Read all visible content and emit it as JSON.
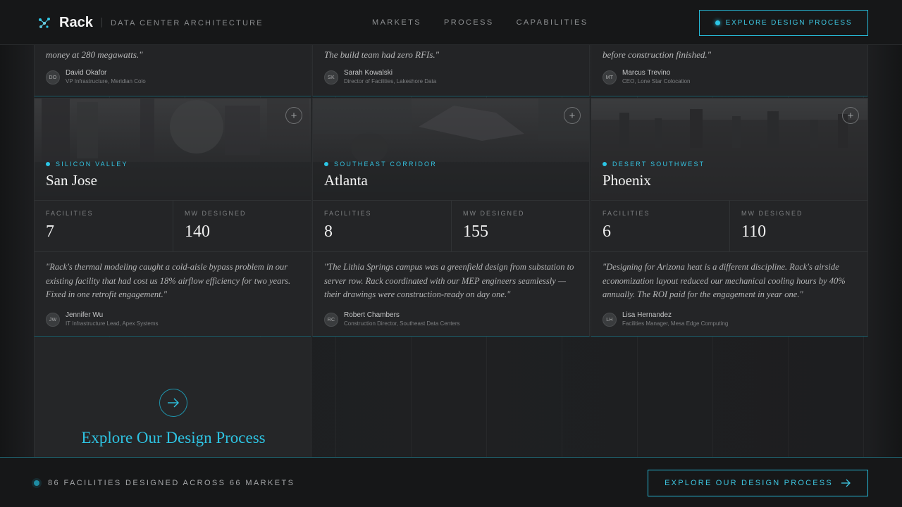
{
  "header": {
    "brand": "Rack",
    "tagline": "DATA CENTER ARCHITECTURE",
    "nav": [
      "MARKETS",
      "PROCESS",
      "CAPABILITIES"
    ],
    "cta_label": "EXPLORE DESIGN PROCESS"
  },
  "top_cards": [
    {
      "quote_tail": "money at 280 megawatts.\"",
      "initials": "DO",
      "name": "David Okafor",
      "role": "VP Infrastructure, Meridian Colo"
    },
    {
      "quote_tail": "The build team had zero RFIs.\"",
      "initials": "SK",
      "name": "Sarah Kowalski",
      "role": "Director of Facilities, Lakeshore Data"
    },
    {
      "quote_tail": "before construction finished.\"",
      "initials": "MT",
      "name": "Marcus Trevino",
      "role": "CEO, Lone Star Colocation"
    }
  ],
  "cards": [
    {
      "region": "SILICON VALLEY",
      "city": "San Jose",
      "facilities_label": "FACILITIES",
      "facilities": "7",
      "mw_label": "MW DESIGNED",
      "mw": "140",
      "quote": "\"Rack's thermal modeling caught a cold-aisle bypass problem in our existing facility that had cost us 18% airflow efficiency for two years. Fixed in one retrofit engagement.\"",
      "initials": "JW",
      "name": "Jennifer Wu",
      "role": "IT Infrastructure Lead, Apex Systems"
    },
    {
      "region": "SOUTHEAST CORRIDOR",
      "city": "Atlanta",
      "facilities_label": "FACILITIES",
      "facilities": "8",
      "mw_label": "MW DESIGNED",
      "mw": "155",
      "quote": "\"The Lithia Springs campus was a greenfield design from substation to server row. Rack coordinated with our MEP engineers seamlessly — their drawings were construction-ready on day one.\"",
      "initials": "RC",
      "name": "Robert Chambers",
      "role": "Construction Director, Southeast Data Centers"
    },
    {
      "region": "DESERT SOUTHWEST",
      "city": "Phoenix",
      "facilities_label": "FACILITIES",
      "facilities": "6",
      "mw_label": "MW DESIGNED",
      "mw": "110",
      "quote": "\"Designing for Arizona heat is a different discipline. Rack's airside economization layout reduced our mechanical cooling hours by 40% annually. The ROI paid for the engagement in year one.\"",
      "initials": "LH",
      "name": "Lisa Hernandez",
      "role": "Facilities Manager, Mesa Edge Computing"
    }
  ],
  "cta_card": {
    "title": "Explore Our Design Process"
  },
  "footer": {
    "summary": "86 FACILITIES DESIGNED ACROSS 66 MARKETS",
    "cta_label": "EXPLORE OUR DESIGN PROCESS"
  },
  "colors": {
    "accent": "#2ec3e2",
    "background": "#1c1d1f",
    "card": "#242527"
  }
}
